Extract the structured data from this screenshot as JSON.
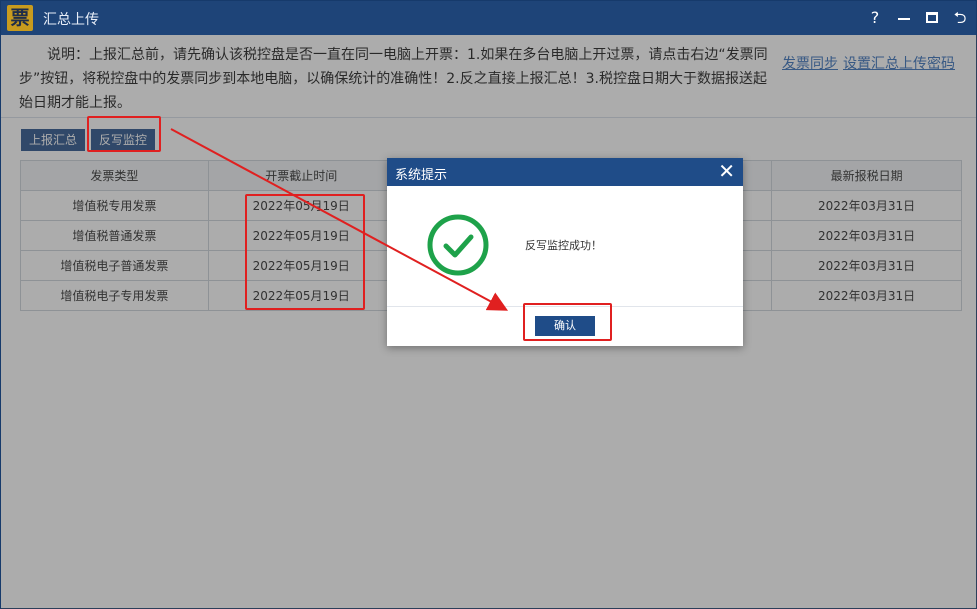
{
  "window": {
    "app_logo": "票",
    "title": "汇总上传",
    "help_label": "?",
    "minimize_label": "—",
    "back_label": "⮌"
  },
  "notice": {
    "text": "说明：上报汇总前，请先确认该税控盘是否一直在同一电脑上开票：1.如果在多台电脑上开过票，请点击右边“发票同步”按钮，将税控盘中的发票同步到本地电脑，以确保统计的准确性！2.反之直接上报汇总！3.税控盘日期大于数据报送起始日期才能上报。",
    "link_sync": "发票同步",
    "link_password": "设置汇总上传密码"
  },
  "toolbar": {
    "upload_label": "上报汇总",
    "writeback_label": "反写监控"
  },
  "table": {
    "headers": [
      "发票类型",
      "开票截止时间",
      "",
      "最新报税日期"
    ],
    "rows": [
      [
        "增值税专用发票",
        "2022年05月19日",
        "",
        "2022年03月31日"
      ],
      [
        "增值税普通发票",
        "2022年05月19日",
        "",
        "2022年03月31日"
      ],
      [
        "增值税电子普通发票",
        "2022年05月19日",
        "",
        "2022年03月31日"
      ],
      [
        "增值税电子专用发票",
        "2022年05月19日",
        "",
        "2022年03月31日"
      ]
    ]
  },
  "dialog": {
    "title": "系统提示",
    "close_label": "✕",
    "message": "反写监控成功！",
    "confirm_label": "确认"
  },
  "colors": {
    "titlebar": "#1e4478",
    "button": "#1e4a86",
    "link": "#2d69b7",
    "highlight": "#e02020",
    "success": "#1ea24a"
  },
  "icons": {
    "app": "ticket-logo-icon",
    "success": "check-circle-icon",
    "close": "close-icon"
  }
}
